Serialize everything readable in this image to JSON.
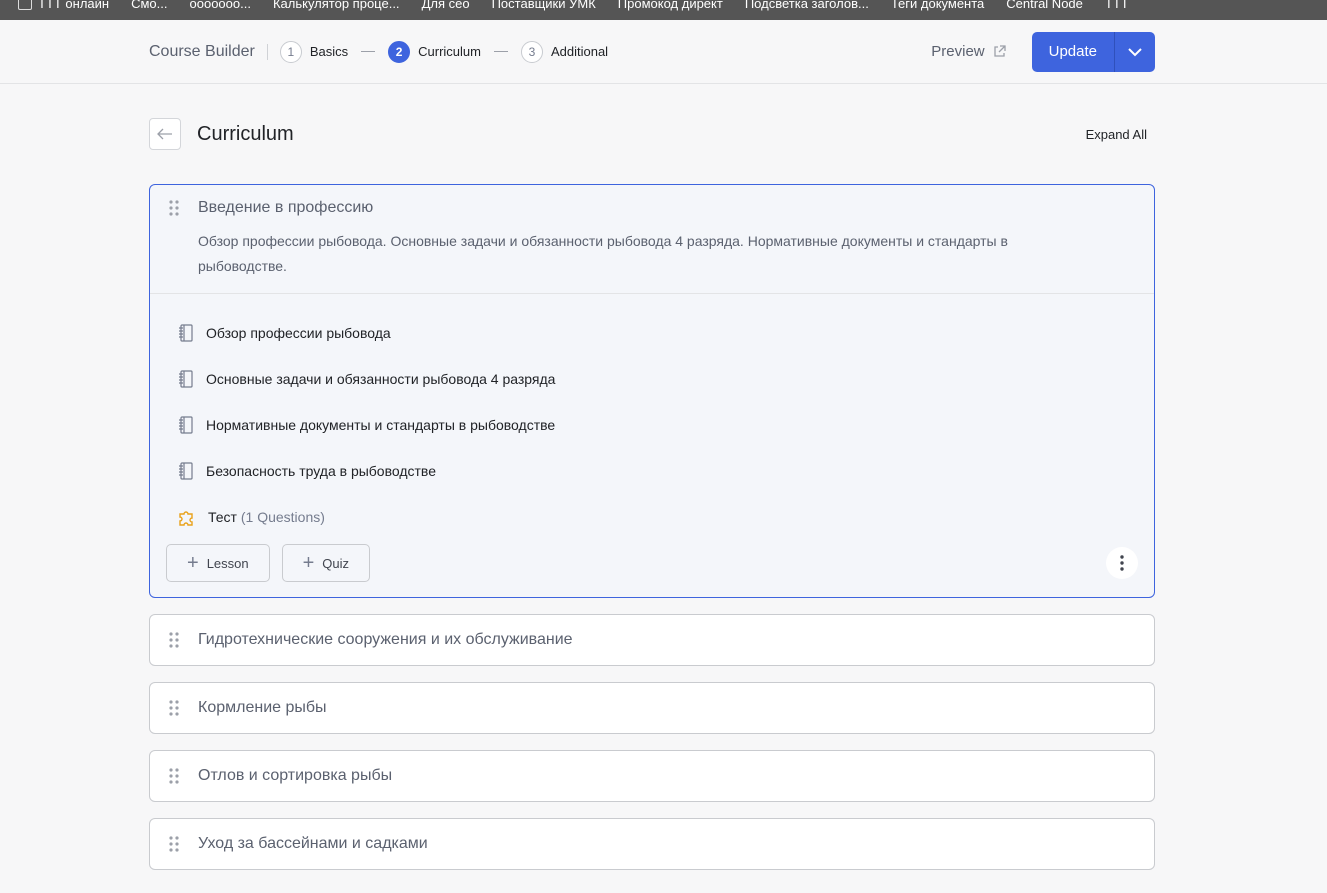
{
  "bookmarks": [
    "ТТТ онлайн",
    "Смо...",
    "ооооооо...",
    "Калькулятор проце...",
    "Для сео",
    "Поставщики УМК",
    "Промокод директ",
    "Подсветка заголов...",
    "Теги документа",
    "Central Node",
    "ТТТ"
  ],
  "header": {
    "brand": "Course Builder",
    "steps": [
      {
        "num": "1",
        "label": "Basics"
      },
      {
        "num": "2",
        "label": "Curriculum"
      },
      {
        "num": "3",
        "label": "Additional"
      }
    ],
    "preview": "Preview",
    "update": "Update"
  },
  "page": {
    "title": "Curriculum",
    "expand_all": "Expand All"
  },
  "open_topic": {
    "title": "Введение в профессию",
    "description": "Обзор профессии рыбовода. Основные задачи и обязанности рыбовода 4 разряда. Нормативные документы и стандарты в рыбоводстве.",
    "lessons": [
      "Обзор профессии рыбовода",
      "Основные задачи и обязанности рыбовода 4 разряда",
      "Нормативные документы и стандарты в рыбоводстве",
      "Безопасность труда в рыбоводстве"
    ],
    "quiz": {
      "title": "Тест",
      "count": "(1 Questions)"
    },
    "add_lesson": "Lesson",
    "add_quiz": "Quiz"
  },
  "topics": [
    "Гидротехнические сооружения и их обслуживание",
    "Кормление рыбы",
    "Отлов и сортировка рыбы",
    "Уход за бассейнами и садками"
  ]
}
